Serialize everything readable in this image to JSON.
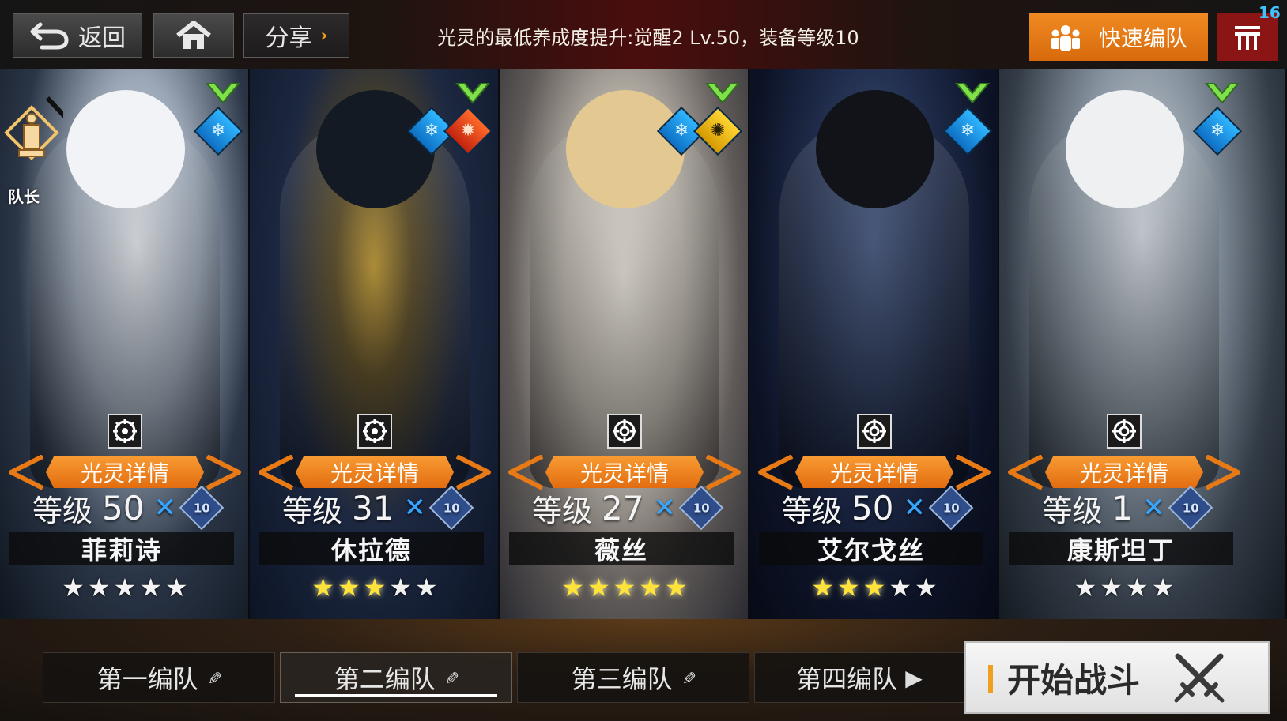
{
  "topbar": {
    "back_label": "返回",
    "share_label": "分享",
    "notice": "光灵的最低养成度提升:觉醒2 Lv.50，装备等级10",
    "quick_team_label": "快速编队",
    "counter": "16"
  },
  "colors": {
    "accent_orange": "#e87a16",
    "danger_red": "#8b1515",
    "awaken_blue": "#35a6ff",
    "star_gold": "#ffe33a"
  },
  "leader_label": "队长",
  "cards": [
    {
      "name": "菲莉诗",
      "level_label": "等级",
      "level": "50",
      "equip_level": "10",
      "detail_label": "光灵详情",
      "elements": [
        "ice"
      ],
      "class_icon": "gear-icon",
      "stars": 5,
      "stars_style": "white",
      "is_leader": true
    },
    {
      "name": "休拉德",
      "level_label": "等级",
      "level": "31",
      "equip_level": "10",
      "detail_label": "光灵详情",
      "elements": [
        "ice",
        "fire"
      ],
      "class_icon": "gear-icon",
      "stars": 5,
      "stars_gold": 3,
      "stars_style": "mixed",
      "is_leader": false
    },
    {
      "name": "薇丝",
      "level_label": "等级",
      "level": "27",
      "equip_level": "10",
      "detail_label": "光灵详情",
      "elements": [
        "ice",
        "dark"
      ],
      "class_icon": "target-icon",
      "stars": 5,
      "stars_gold": 5,
      "stars_style": "gold",
      "is_leader": false
    },
    {
      "name": "艾尔戈丝",
      "level_label": "等级",
      "level": "50",
      "equip_level": "10",
      "detail_label": "光灵详情",
      "elements": [
        "ice"
      ],
      "class_icon": "target-icon",
      "stars": 5,
      "stars_gold": 3,
      "stars_style": "mixed",
      "is_leader": false
    },
    {
      "name": "康斯坦丁",
      "level_label": "等级",
      "level": "1",
      "equip_level": "10",
      "detail_label": "光灵详情",
      "elements": [
        "ice"
      ],
      "class_icon": "target-icon",
      "stars": 4,
      "stars_style": "white",
      "is_leader": false
    }
  ],
  "tabs": [
    {
      "label": "第一编队",
      "active": false
    },
    {
      "label": "第二编队",
      "active": true
    },
    {
      "label": "第三编队",
      "active": false
    },
    {
      "label": "第四编队",
      "active": false
    }
  ],
  "start_label": "开始战斗"
}
